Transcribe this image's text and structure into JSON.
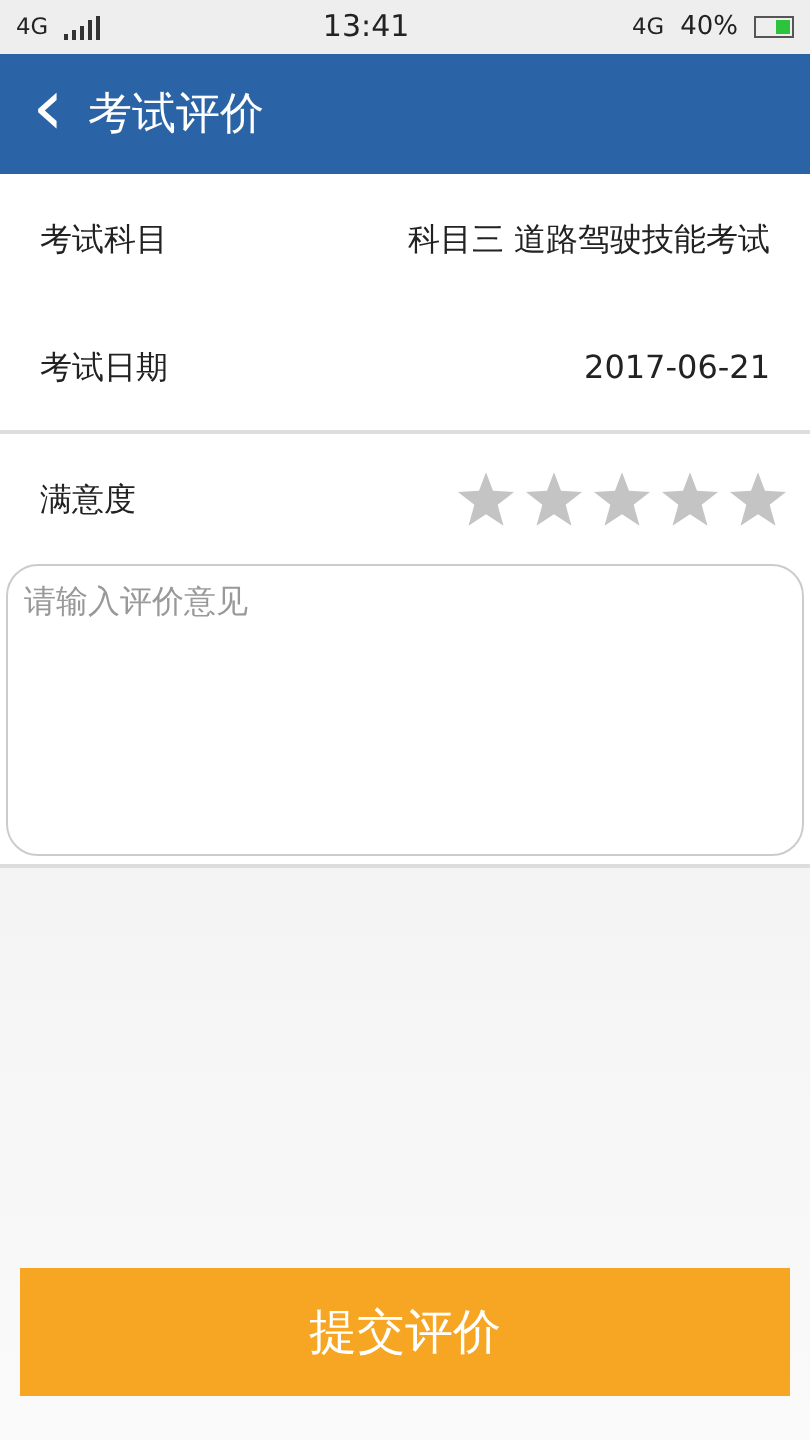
{
  "status_bar": {
    "network": "4G",
    "time": "13:41",
    "data_network": "4G",
    "battery": "40%"
  },
  "header": {
    "back_icon": "‹",
    "title": "考试评价"
  },
  "fields": [
    {
      "label": "考试科目",
      "value": "科目三 道路驾驶技能考试"
    },
    {
      "label": "考试日期",
      "value": "2017-06-21"
    }
  ],
  "rating": {
    "label": "满意度",
    "stars": 0
  },
  "comment": {
    "placeholder": "请输入评价意见"
  },
  "submit": "提交评价"
}
